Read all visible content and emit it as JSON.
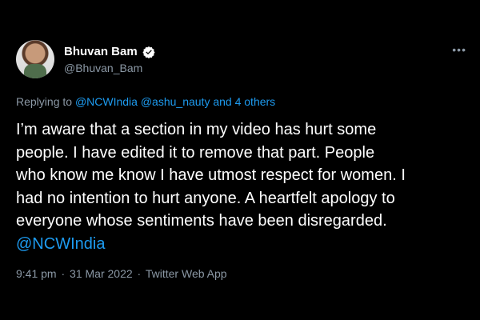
{
  "author": {
    "display_name": "Bhuvan Bam",
    "handle": "@Bhuvan_Bam",
    "verified_icon": "verified-badge-icon"
  },
  "reply": {
    "prefix": "Replying to",
    "mention_1": "@NCWIndia",
    "mention_2": "@ashu_nauty",
    "others": "and 4 others"
  },
  "tweet": {
    "text_line_1": "I’m aware that a section in my video has hurt some",
    "text_line_2": "people. I have edited it to remove that part. People",
    "text_line_3": "who know me know I have utmost respect for women. I",
    "text_line_4": "had no intention to hurt anyone. A heartfelt apology to",
    "text_line_5": "everyone whose sentiments have been disregarded.",
    "mention": "@NCWIndia"
  },
  "meta": {
    "time": "9:41 pm",
    "date": "31 Mar 2022",
    "source": "Twitter Web App"
  },
  "colors": {
    "background": "#000000",
    "text": "#ffffff",
    "muted": "#8b98a5",
    "link": "#1d9bf0"
  }
}
